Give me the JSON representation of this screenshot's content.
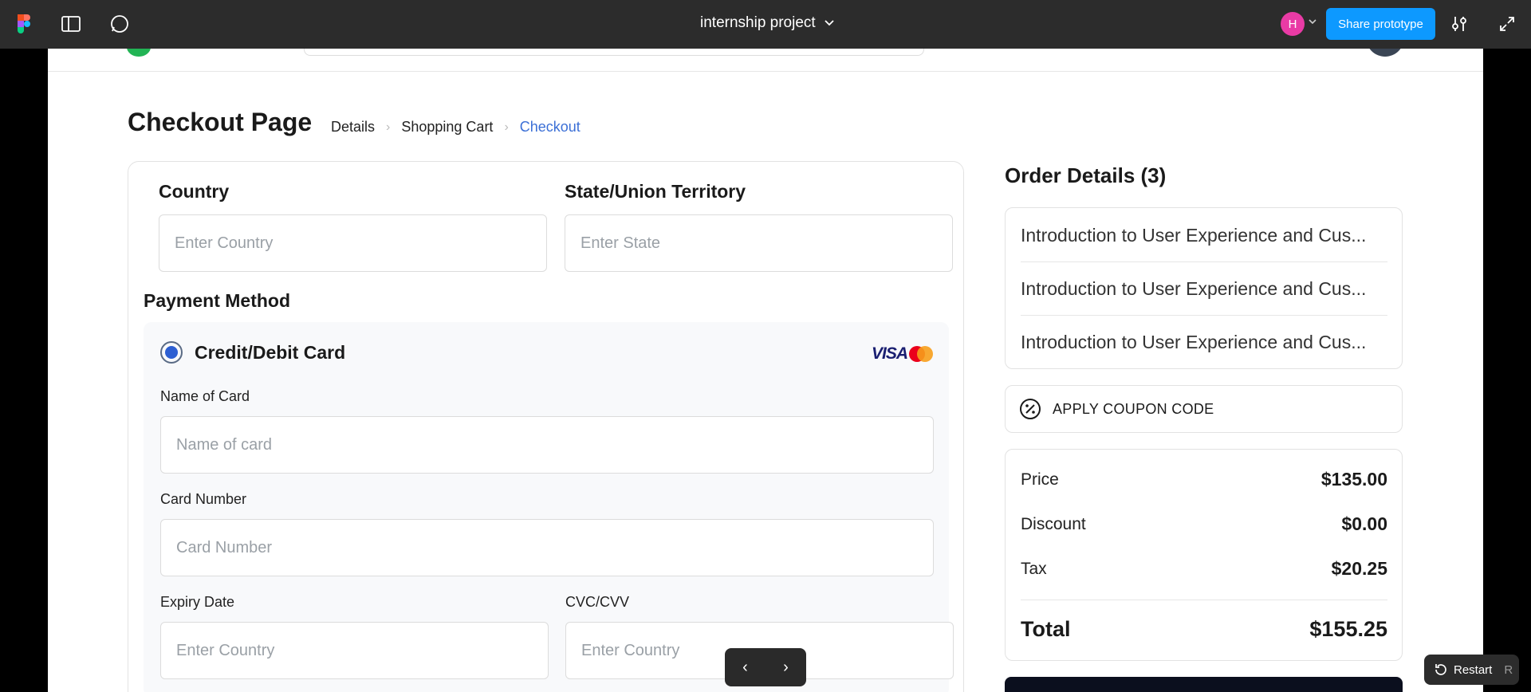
{
  "toolbar": {
    "project_title": "internship project",
    "avatar_initial": "H",
    "share_label": "Share prototype"
  },
  "page": {
    "title": "Checkout Page",
    "breadcrumb": [
      "Details",
      "Shopping Cart",
      "Checkout"
    ]
  },
  "address": {
    "country_label": "Country",
    "country_placeholder": "Enter Country",
    "state_label": "State/Union Territory",
    "state_placeholder": "Enter State"
  },
  "payment": {
    "title": "Payment Method",
    "option_label": "Credit/Debit Card",
    "visa_text": "VISA",
    "name_label": "Name of Card",
    "name_placeholder": "Name of card",
    "number_label": "Card Number",
    "number_placeholder": "Card Number",
    "expiry_label": "Expiry Date",
    "expiry_placeholder": "Enter Country",
    "cvc_label": "CVC/CVV",
    "cvc_placeholder": "Enter Country"
  },
  "order": {
    "title": "Order Details (3)",
    "items": [
      "Introduction to User Experience and Cus...",
      "Introduction to User Experience and Cus...",
      "Introduction to User Experience and Cus..."
    ],
    "coupon_label": "APPLY COUPON CODE",
    "price_label": "Price",
    "price_value": "$135.00",
    "discount_label": "Discount",
    "discount_value": "$0.00",
    "tax_label": "Tax",
    "tax_value": "$20.25",
    "total_label": "Total",
    "total_value": "$155.25"
  },
  "prototype": {
    "restart_label": "Restart",
    "restart_key": "R"
  },
  "colors": {
    "accent": "#3b6fd6",
    "share_button": "#0d99ff",
    "avatar": "#e93ba5"
  }
}
